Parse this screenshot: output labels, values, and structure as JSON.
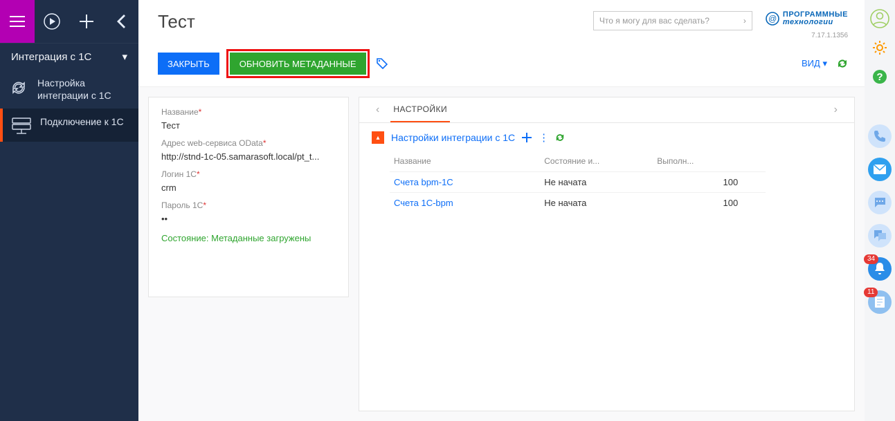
{
  "sidebar": {
    "section": "Интеграция с 1С",
    "items": [
      {
        "label": "Настройка интеграции с 1С"
      },
      {
        "label": "Подключение к 1С"
      }
    ]
  },
  "header": {
    "title": "Тест",
    "search_placeholder": "Что я могу для вас сделать?",
    "logo1": "ПРОГРАММНЫЕ",
    "logo2": "технологии",
    "version": "7.17.1.1356",
    "close": "ЗАКРЫТЬ",
    "update": "ОБНОВИТЬ МЕТАДАННЫЕ",
    "view": "ВИД"
  },
  "form": {
    "name_label": "Название",
    "name_value": "Тест",
    "url_label": "Адрес web-сервиса OData",
    "url_value": "http://stnd-1c-05.samarasoft.local/pt_t...",
    "login_label": "Логин 1С",
    "login_value": "crm",
    "pass_label": "Пароль 1С",
    "pass_value": "••",
    "status": "Состояние: Метаданные загружены"
  },
  "detail": {
    "tab": "НАСТРОЙКИ",
    "title": "Настройки интеграции с 1С",
    "col1": "Название",
    "col2": "Состояние и...",
    "col3": "Выполн...",
    "rows": [
      {
        "name": "Счета bpm-1C",
        "state": "Не начата",
        "done": "100"
      },
      {
        "name": "Счета 1C-bpm",
        "state": "Не начата",
        "done": "100"
      }
    ]
  },
  "rail": {
    "badge1": "34",
    "badge2": "11"
  }
}
